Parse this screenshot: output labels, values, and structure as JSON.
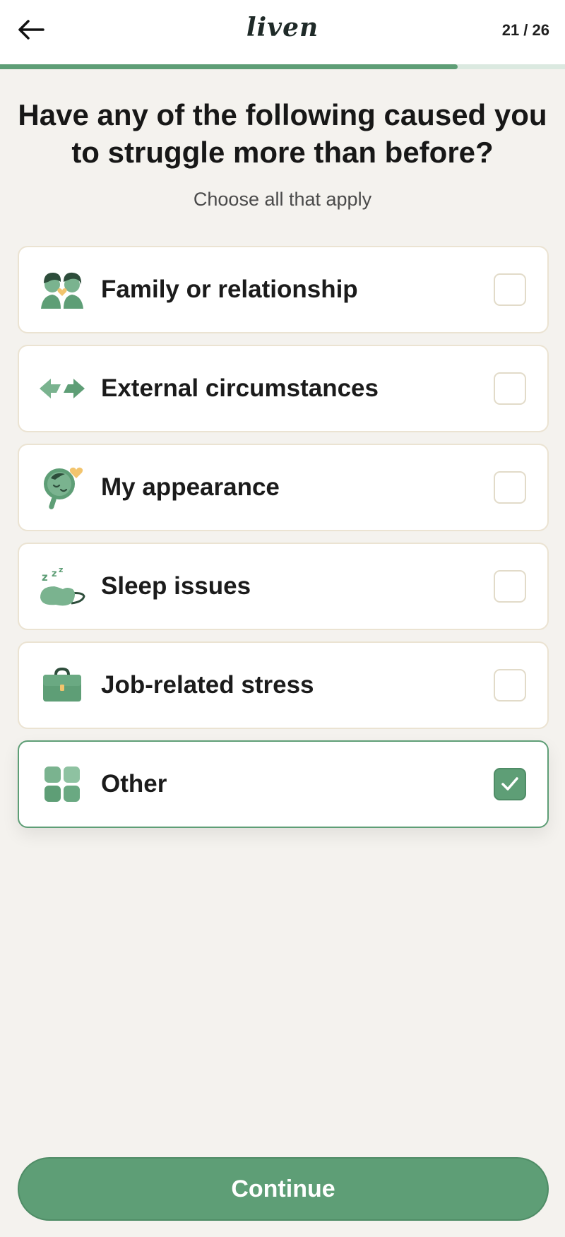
{
  "header": {
    "logo_text": "liven",
    "step_text": "21 / 26",
    "progress_fraction": 0.81
  },
  "question": {
    "title": "Have any of the following caused you to struggle more than before?",
    "subtitle": "Choose all that apply"
  },
  "options": [
    {
      "label": "Family or relationship",
      "icon": "family-icon",
      "checked": false
    },
    {
      "label": "External circumstances",
      "icon": "arrows-icon",
      "checked": false
    },
    {
      "label": "My appearance",
      "icon": "mirror-icon",
      "checked": false
    },
    {
      "label": "Sleep issues",
      "icon": "sleep-mask-icon",
      "checked": false
    },
    {
      "label": "Job-related stress",
      "icon": "briefcase-icon",
      "checked": false
    },
    {
      "label": "Other",
      "icon": "grid-icon",
      "checked": true
    }
  ],
  "continue_label": "Continue",
  "colors": {
    "accent": "#5e9e76",
    "background": "#f4f2ee",
    "card_border": "#ebe3d2",
    "progress_track": "#dbe9e0"
  }
}
